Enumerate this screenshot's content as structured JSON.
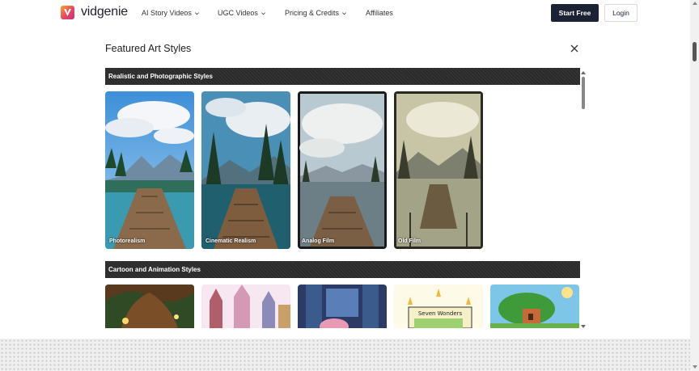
{
  "brand": {
    "name": "vidgenie",
    "logo_icon": "v-logo-icon",
    "logo_colors": [
      "#f5a524",
      "#e8475f",
      "#c2338a"
    ]
  },
  "nav": {
    "items": [
      {
        "label": "AI Story Videos",
        "has_dropdown": true
      },
      {
        "label": "UGC Videos",
        "has_dropdown": true
      },
      {
        "label": "Pricing & Credits",
        "has_dropdown": true
      },
      {
        "label": "Affiliates",
        "has_dropdown": false
      }
    ],
    "start_free": "Start Free",
    "login": "Login"
  },
  "modal": {
    "title": "Featured Art Styles",
    "close_icon": "close-icon",
    "sections": [
      {
        "title": "Realistic and Photographic Styles",
        "styles": [
          "Photorealism",
          "Cinematic Realism",
          "Analog Film",
          "Old Film"
        ]
      },
      {
        "title": "Cartoon and Animation Styles",
        "thumbnails": [
          "glowing-tree-forest",
          "fairytale-castle",
          "pink-creature-window",
          "seven-wonders-sign",
          "cartoon-treehouse"
        ],
        "sign_text": "Seven Wonders"
      }
    ]
  },
  "colors": {
    "primary_button": "#1b2233",
    "section_bar": "#2b2b2b"
  }
}
